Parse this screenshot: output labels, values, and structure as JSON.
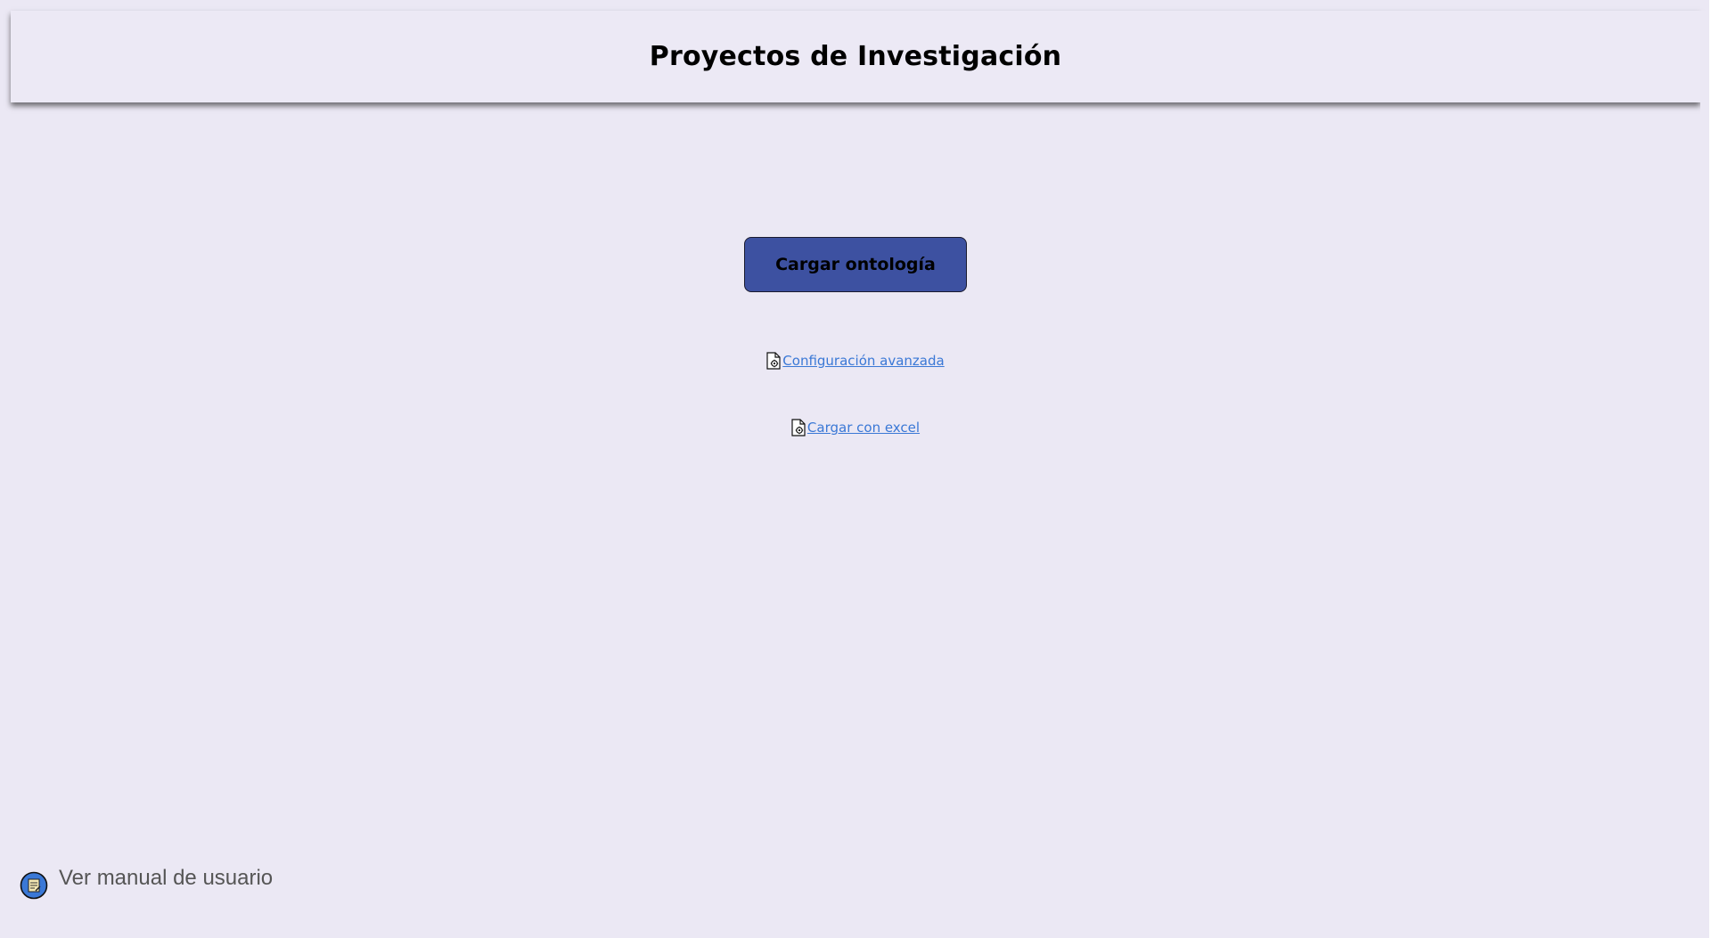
{
  "header": {
    "title": "Proyectos de Investigación"
  },
  "main": {
    "load_button_label": "Cargar ontología",
    "links": [
      {
        "label": "Configuración avanzada",
        "icon": "document-gear-icon"
      },
      {
        "label": "Cargar con excel",
        "icon": "document-gear-icon"
      }
    ]
  },
  "footer": {
    "manual_label": "Ver manual de usuario",
    "manual_icon": "notepad-icon"
  },
  "colors": {
    "background": "#ebe8f4",
    "button": "#3d51a1",
    "link": "#3a78d6"
  }
}
